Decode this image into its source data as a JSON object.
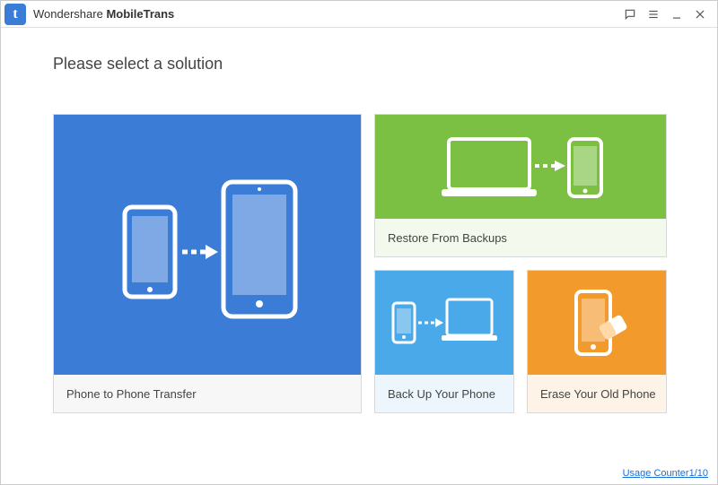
{
  "app": {
    "brand": "Wondershare",
    "product": "MobileTrans"
  },
  "heading": "Please select a solution",
  "cards": {
    "transfer": {
      "label": "Phone to Phone Transfer"
    },
    "restore": {
      "label": "Restore From Backups"
    },
    "backup": {
      "label": "Back Up Your Phone"
    },
    "erase": {
      "label": "Erase Your Old Phone"
    }
  },
  "footer": {
    "usage_counter": "Usage Counter1/10"
  },
  "colors": {
    "blue": "#3b7cd6",
    "green": "#7bc043",
    "skyblue": "#4aa9e8",
    "orange": "#f39a2d"
  }
}
